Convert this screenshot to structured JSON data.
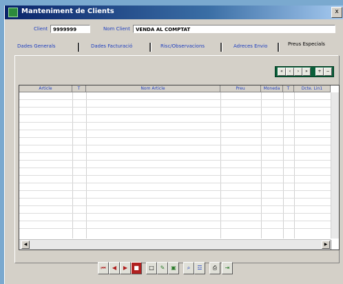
{
  "window": {
    "title": "Manteniment de Clients",
    "close_label": "x"
  },
  "header": {
    "client_label": "Client",
    "client_value": "9999999",
    "nom_client_label": "Nom Client",
    "nom_client_value": "VENDA AL COMPTAT"
  },
  "tabs": [
    {
      "label": "Dades Generals"
    },
    {
      "label": "Dades Facturació"
    },
    {
      "label": "Risc/Observacions"
    },
    {
      "label": "Adreces Envio"
    },
    {
      "label": "Preus Especials",
      "active": true
    }
  ],
  "nav_buttons": [
    "«",
    "‹",
    "›",
    "»",
    "+",
    "−"
  ],
  "grid": {
    "columns": [
      "Article",
      "T",
      "Nom Article",
      "Preu",
      "Moneda",
      "T",
      "Dcte. Lin1"
    ],
    "rows": []
  },
  "bottom_toolbar": [
    {
      "icon": "first-record-icon",
      "glyph": "⏮"
    },
    {
      "icon": "prev-record-icon",
      "glyph": "◀"
    },
    {
      "icon": "next-record-icon",
      "glyph": "▶"
    },
    {
      "icon": "stop-icon",
      "glyph": "■"
    },
    {
      "icon": "new-document-icon",
      "glyph": "□"
    },
    {
      "icon": "edit-icon",
      "glyph": "✎"
    },
    {
      "icon": "save-icon",
      "glyph": "▣"
    },
    {
      "icon": "search-icon",
      "glyph": "⌕"
    },
    {
      "icon": "filter-icon",
      "glyph": "☲"
    },
    {
      "icon": "print-icon",
      "glyph": "⎙"
    },
    {
      "icon": "exit-icon",
      "glyph": "⇥"
    }
  ],
  "colors": {
    "title_bar": "#0a246a",
    "label_blue": "#1f3fbf",
    "nav_green": "#0b5f3a",
    "stop_red": "#b02020"
  }
}
